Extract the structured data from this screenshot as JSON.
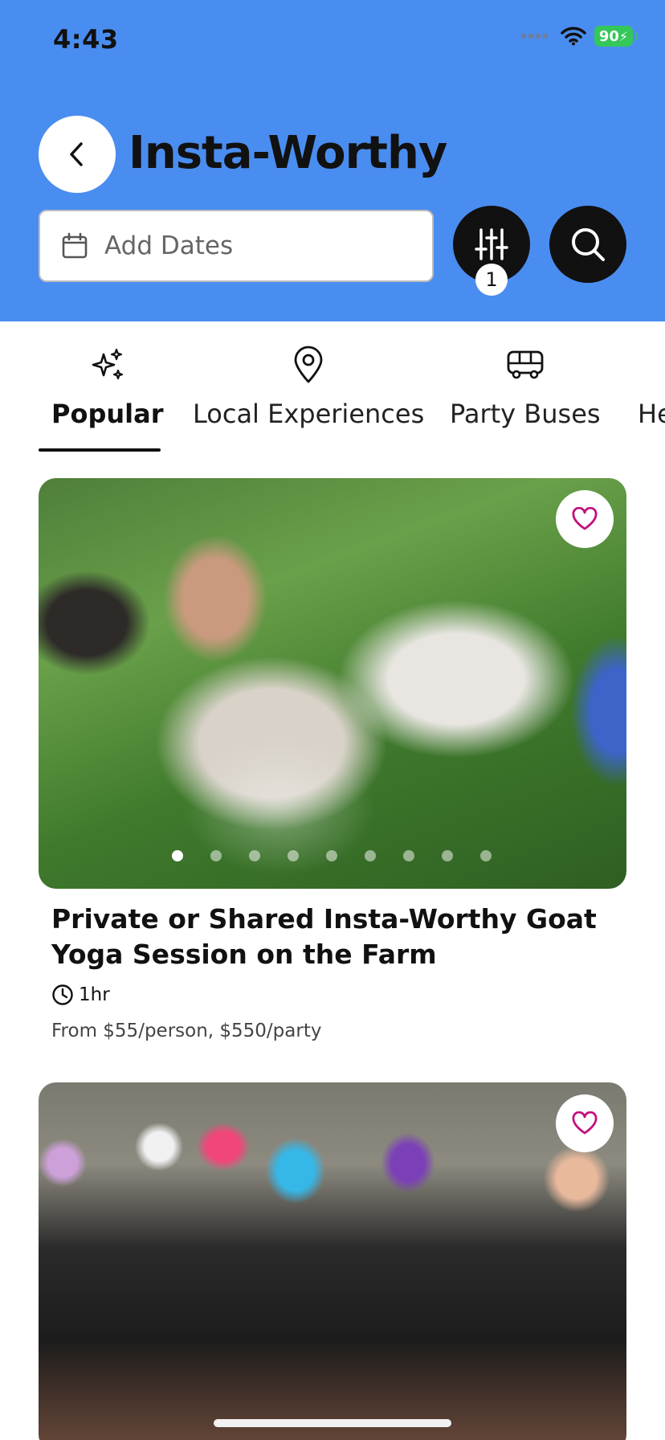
{
  "status_bar": {
    "time": "4:43",
    "battery": "90"
  },
  "header": {
    "title": "Insta-Worthy",
    "date_placeholder": "Add Dates",
    "filter_count": "1",
    "icons": {
      "back": "chevron-left-icon",
      "calendar": "calendar-icon",
      "filter": "sliders-icon",
      "search": "search-icon"
    }
  },
  "tabs": [
    {
      "label": "Popular",
      "icon": "sparkles-icon",
      "active": true
    },
    {
      "label": "Local Experiences",
      "icon": "map-pin-icon",
      "active": false
    },
    {
      "label": "Party Buses",
      "icon": "bus-icon",
      "active": false
    },
    {
      "label": "He",
      "icon": "",
      "active": false
    }
  ],
  "listings": [
    {
      "title": "Private or Shared Insta-Worthy Goat Yoga Session on the Farm",
      "duration": "1hr",
      "price": "From $55/person, $550/party",
      "photo_count": 9,
      "active_photo": 1,
      "favorite": false
    },
    {
      "title": "",
      "favorite": false
    }
  ],
  "colors": {
    "header_bg": "#4a8df0",
    "heart": "#c2127c",
    "battery": "#34c759"
  }
}
